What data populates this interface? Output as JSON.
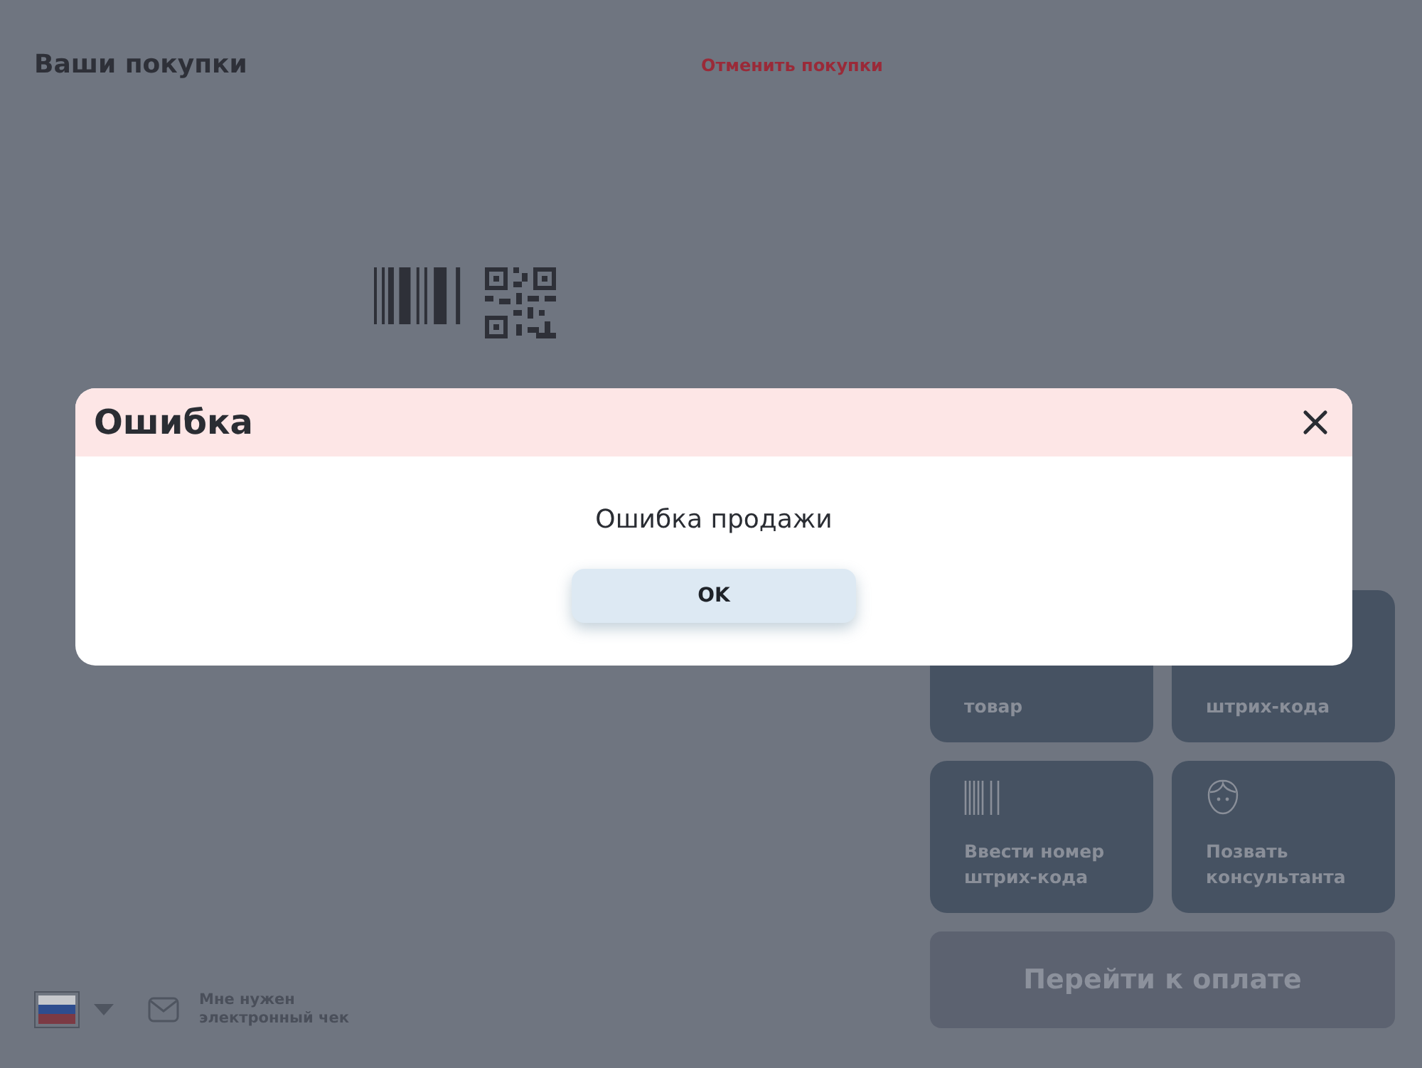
{
  "header": {
    "title": "Ваши покупки",
    "cancel_link": "Отменить покупки"
  },
  "actions": [
    {
      "kind": "covered",
      "lines": [
        "товар"
      ]
    },
    {
      "kind": "covered",
      "lines": [
        "штрих-кода"
      ]
    },
    {
      "kind": "barcode",
      "lines": [
        "Ввести номер",
        "штрих-кода"
      ]
    },
    {
      "kind": "consultant",
      "lines": [
        "Позвать",
        "консультанта"
      ]
    }
  ],
  "pay_button": {
    "label": "Перейти к оплате",
    "disabled": true
  },
  "footer": {
    "receipt_lines": [
      "Мне нужен",
      "электронный чек"
    ]
  },
  "dialog": {
    "title": "Ошибка",
    "message": "Ошибка продажи",
    "button": "OK"
  }
}
